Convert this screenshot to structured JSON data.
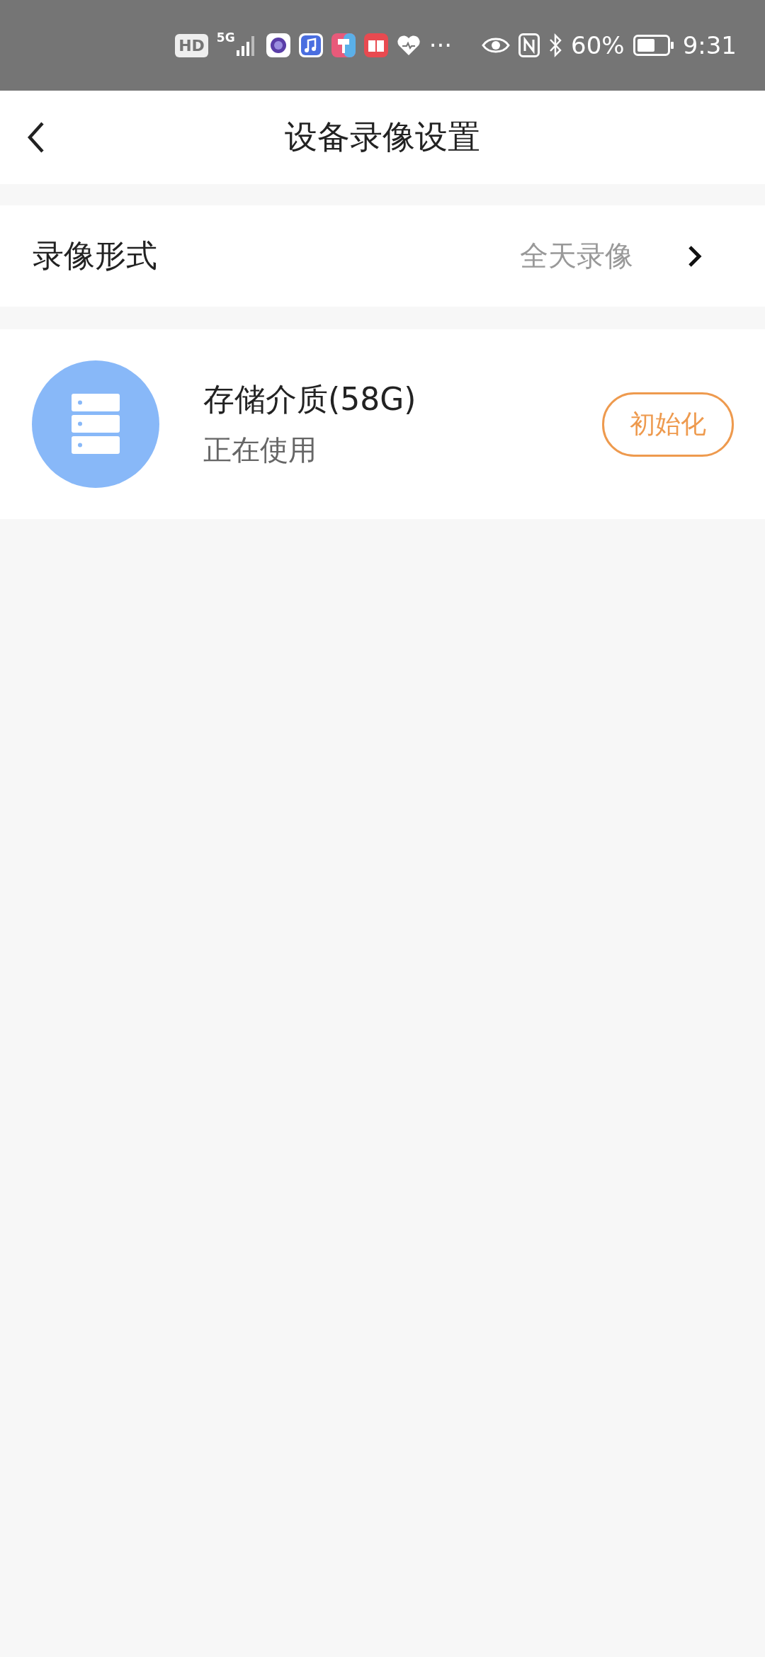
{
  "status_bar": {
    "hd": "HD",
    "network": "5G",
    "more": "···",
    "battery": "60%",
    "time": "9:31"
  },
  "header": {
    "title": "设备录像设置"
  },
  "record_mode": {
    "label": "录像形式",
    "value": "全天录像"
  },
  "storage": {
    "name": "存储介质(58G)",
    "status": "正在使用",
    "action": "初始化"
  }
}
